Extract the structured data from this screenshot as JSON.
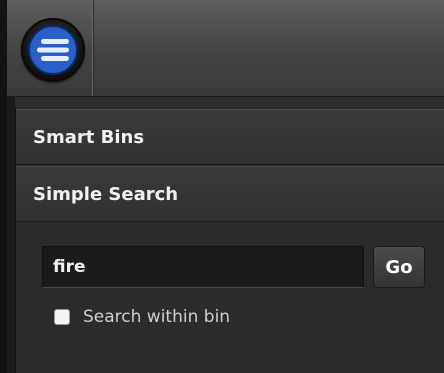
{
  "app": {
    "logo_icon": "app-logo-icon"
  },
  "panels": {
    "smart_bins": {
      "label": "Smart Bins"
    },
    "simple_search": {
      "label": "Simple Search"
    }
  },
  "search": {
    "value": "fire",
    "go_label": "Go",
    "within_bin_label": "Search within bin",
    "within_bin_checked": false
  },
  "colors": {
    "logo_blue": "#2a5fc9",
    "panel_bg": "#2b2b2b",
    "header_bg": "#333333",
    "text": "#f2f2f2"
  }
}
